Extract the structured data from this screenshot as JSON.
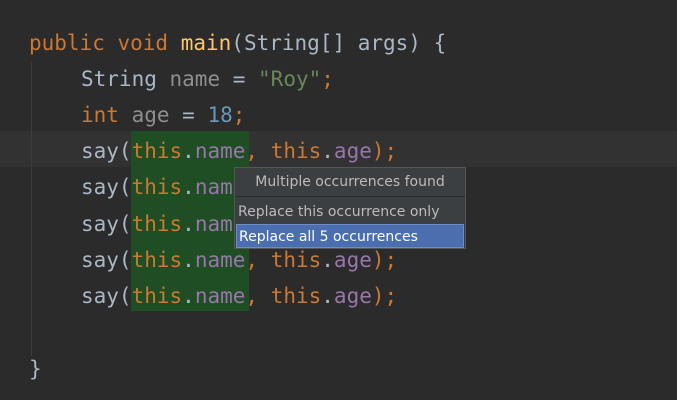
{
  "code": {
    "lines": [
      [
        {
          "t": "public void ",
          "c": "kw"
        },
        {
          "t": "main",
          "c": "fn"
        },
        {
          "t": "(String[] args) {",
          "c": "plain"
        }
      ],
      [
        {
          "t": "String ",
          "c": "plain"
        },
        {
          "t": "name",
          "c": "unused"
        },
        {
          "t": " = ",
          "c": "plain"
        },
        {
          "t": "\"Roy\"",
          "c": "str"
        },
        {
          "t": ";",
          "c": "kw"
        }
      ],
      [
        {
          "t": "int ",
          "c": "kw"
        },
        {
          "t": "age",
          "c": "unused"
        },
        {
          "t": " = ",
          "c": "plain"
        },
        {
          "t": "18",
          "c": "num"
        },
        {
          "t": ";",
          "c": "kw"
        }
      ],
      [
        {
          "t": "say(",
          "c": "plain"
        },
        {
          "t": "this",
          "c": "kw"
        },
        {
          "t": ".",
          "c": "plain"
        },
        {
          "t": "name",
          "c": "field"
        },
        {
          "t": ", ",
          "c": "kw"
        },
        {
          "t": "this",
          "c": "kw"
        },
        {
          "t": ".",
          "c": "plain"
        },
        {
          "t": "age",
          "c": "field"
        },
        {
          "t": ");",
          "c": "kw"
        }
      ],
      [
        {
          "t": "say(",
          "c": "plain"
        },
        {
          "t": "this",
          "c": "kw"
        },
        {
          "t": ".",
          "c": "plain"
        },
        {
          "t": "nam",
          "c": "field"
        }
      ],
      [
        {
          "t": "say(",
          "c": "plain"
        },
        {
          "t": "this",
          "c": "kw"
        },
        {
          "t": ".",
          "c": "plain"
        },
        {
          "t": "nam",
          "c": "field"
        }
      ],
      [
        {
          "t": "say(",
          "c": "plain"
        },
        {
          "t": "this",
          "c": "kw"
        },
        {
          "t": ".",
          "c": "plain"
        },
        {
          "t": "name",
          "c": "field"
        },
        {
          "t": ", ",
          "c": "kw"
        },
        {
          "t": "this",
          "c": "kw"
        },
        {
          "t": ".",
          "c": "plain"
        },
        {
          "t": "age",
          "c": "field"
        },
        {
          "t": ");",
          "c": "kw"
        }
      ],
      [
        {
          "t": "say(",
          "c": "plain"
        },
        {
          "t": "this",
          "c": "kw"
        },
        {
          "t": ".",
          "c": "plain"
        },
        {
          "t": "name",
          "c": "field"
        },
        {
          "t": ", ",
          "c": "kw"
        },
        {
          "t": "this",
          "c": "kw"
        },
        {
          "t": ".",
          "c": "plain"
        },
        {
          "t": "age",
          "c": "field"
        },
        {
          "t": ");",
          "c": "kw"
        }
      ],
      [],
      [
        {
          "t": "}",
          "c": "plain"
        }
      ]
    ]
  },
  "popup": {
    "title": "Multiple occurrences found",
    "option_single": "Replace this occurrence only",
    "option_all": "Replace all 5 occurrences"
  },
  "colors": {
    "background": "#2b2b2b",
    "keyword": "#cc7832",
    "method": "#ffc66d",
    "string": "#6a8759",
    "number": "#6897bb",
    "field": "#9876aa",
    "selection_highlight": "#1f4d24",
    "popup_selected": "#4b6eaf"
  }
}
